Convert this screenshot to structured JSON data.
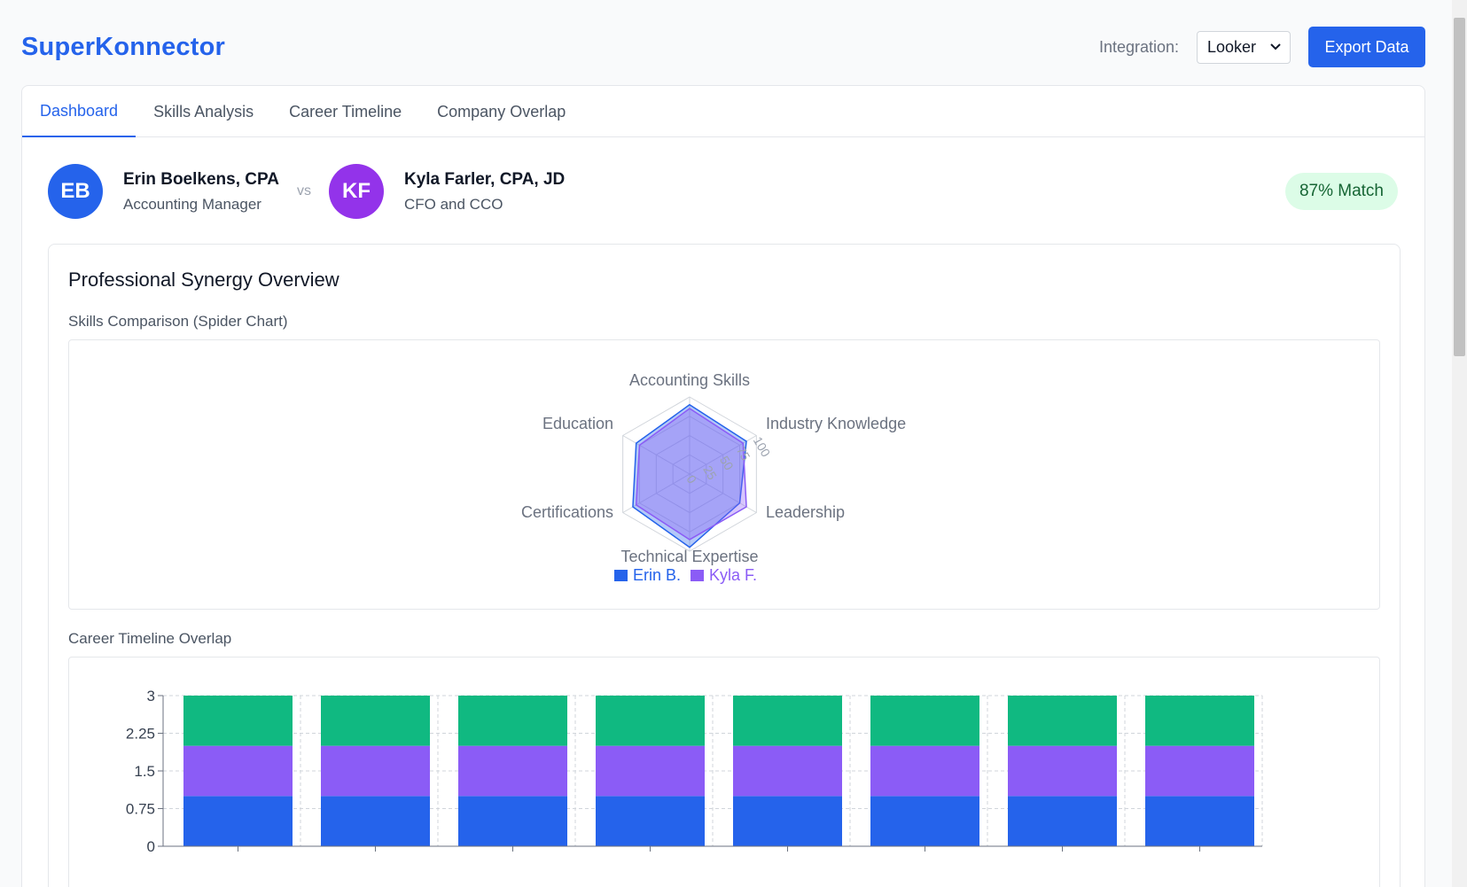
{
  "app": {
    "title": "SuperKonnector"
  },
  "header": {
    "integration_label": "Integration:",
    "integration_value": "Looker",
    "export_label": "Export Data"
  },
  "tabs": [
    {
      "label": "Dashboard",
      "active": true
    },
    {
      "label": "Skills Analysis",
      "active": false
    },
    {
      "label": "Career Timeline",
      "active": false
    },
    {
      "label": "Company Overlap",
      "active": false
    }
  ],
  "comparison": {
    "person_a": {
      "initials": "EB",
      "name": "Erin Boelkens, CPA",
      "role": "Accounting Manager",
      "color": "#2563eb"
    },
    "vs": "vs",
    "person_b": {
      "initials": "KF",
      "name": "Kyla Farler, CPA, JD",
      "role": "CFO and CCO",
      "color": "#9333ea"
    },
    "match": "87% Match"
  },
  "panel": {
    "title": "Professional Synergy Overview",
    "skills_label": "Skills Comparison (Spider Chart)",
    "timeline_label": "Career Timeline Overlap"
  },
  "colors": {
    "accent": "#2563eb",
    "purple": "#8b5cf6",
    "green": "#10b981",
    "match_bg": "#dcfce7"
  },
  "chart_data": [
    {
      "type": "radar",
      "axes": [
        "Accounting Skills",
        "Industry Knowledge",
        "Leadership",
        "Technical Expertise",
        "Certifications",
        "Education"
      ],
      "range": [
        0,
        100
      ],
      "ticks": [
        "0",
        "25",
        "50",
        "75",
        "100"
      ],
      "legend_position": "bottom",
      "series": [
        {
          "name": "Erin B.",
          "color": "#2563eb",
          "values": [
            90,
            85,
            75,
            95,
            85,
            80
          ]
        },
        {
          "name": "Kyla F.",
          "color": "#8b5cf6",
          "values": [
            85,
            80,
            85,
            85,
            80,
            75
          ]
        }
      ]
    },
    {
      "type": "bar",
      "stacked": true,
      "categories": [
        "",
        "",
        "",
        "",
        "",
        "",
        "",
        ""
      ],
      "ylim": [
        0,
        3
      ],
      "yticks": [
        "0",
        "0.75",
        "1.5",
        "2.25",
        "3"
      ],
      "grid": true,
      "series": [
        {
          "color": "#2563eb",
          "values": [
            1,
            1,
            1,
            1,
            1,
            1,
            1,
            1
          ]
        },
        {
          "color": "#8b5cf6",
          "values": [
            1,
            1,
            1,
            1,
            1,
            1,
            1,
            1
          ]
        },
        {
          "color": "#10b981",
          "values": [
            1,
            1,
            1,
            1,
            1,
            1,
            1,
            1
          ]
        }
      ]
    }
  ]
}
